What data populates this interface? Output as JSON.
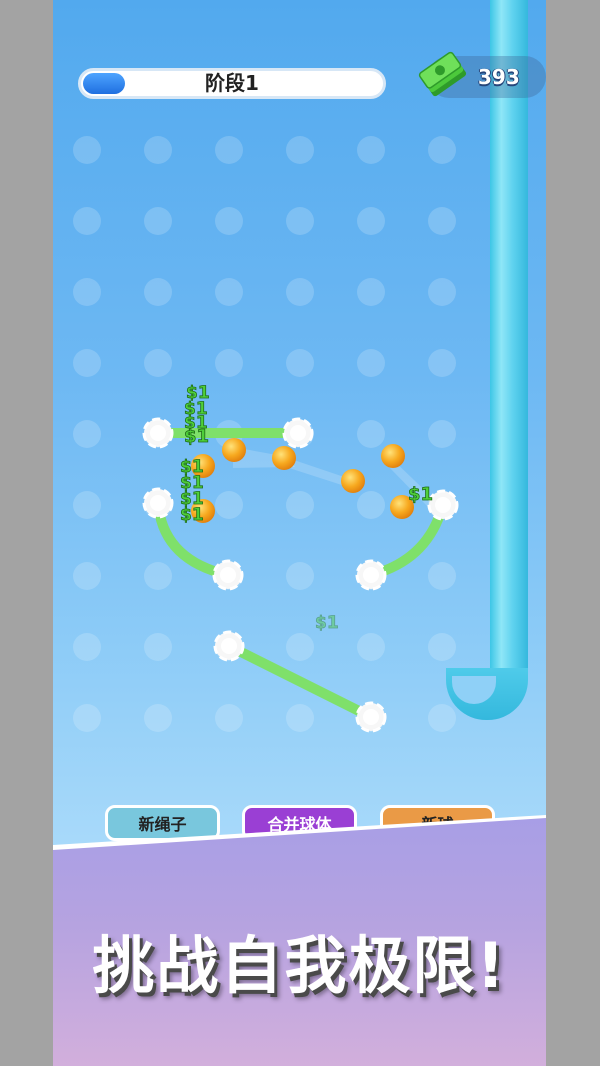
{
  "level": {
    "label": "阶段1",
    "progress": 0.14
  },
  "currency": {
    "amount": "393",
    "icon": "cash-stack-icon"
  },
  "reward_label": "$1",
  "buttons": {
    "new_rope": "新绳子",
    "merge_balls": "合并球体",
    "new_ball": "新球"
  },
  "promo": {
    "slogan": "挑战自我极限!"
  },
  "colors": {
    "rope": "#7fe06a",
    "ball": "#f6a623",
    "pipe": "#4fd0ee",
    "money_text": "#4fcf3a",
    "banner": "#b3a3e2"
  }
}
